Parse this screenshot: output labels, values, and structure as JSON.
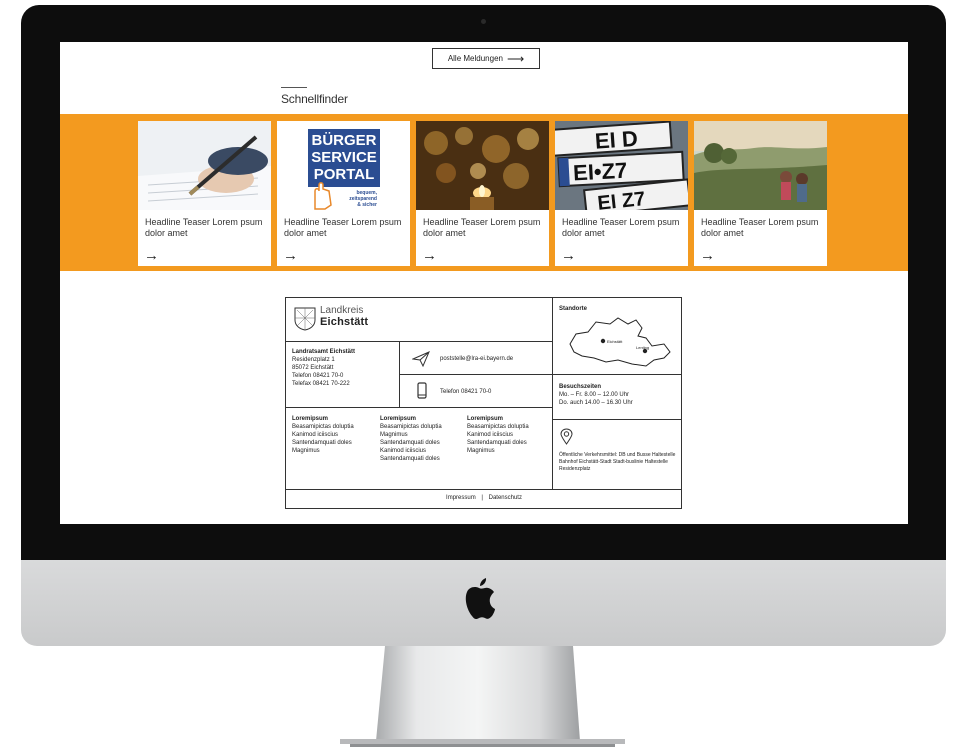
{
  "header": {
    "all_button_label": "Alle Meldungen",
    "arrow": "⟶"
  },
  "schnellfinder": {
    "title": "Schnellfinder",
    "cards": [
      {
        "image": "hand-writing-pen-photo",
        "text": "Headline Teaser Lorem psum dolor amet",
        "arrow": "→"
      },
      {
        "image": "buerger-service-portal-logo",
        "text": "Headline Teaser Lorem psum dolor amet",
        "arrow": "→"
      },
      {
        "image": "candle-bokeh-photo",
        "text": "Headline Teaser Lorem psum dolor amet",
        "arrow": "→"
      },
      {
        "image": "license-plates-photo",
        "text": "Headline Teaser Lorem psum dolor amet",
        "arrow": "→"
      },
      {
        "image": "hikers-landscape-photo",
        "text": "Headline Teaser Lorem psum dolor amet",
        "arrow": "→"
      }
    ],
    "portal_lines": [
      "BÜRGER",
      "SERVICE",
      "PORTAL"
    ],
    "portal_tagline": [
      "bequem,",
      "zeitsparend",
      "& sicher"
    ],
    "plate_texts": [
      "EI D",
      "EI•Z7",
      "EI Z7"
    ]
  },
  "footer": {
    "logo": {
      "line1": "Landkreis",
      "line2": "Eichstätt"
    },
    "office": {
      "name": "Landratsamt Eichstätt",
      "street": "Residenzplatz 1",
      "city": "85072 Eichstätt",
      "phone": "Telefon 08421 70-0",
      "fax": "Telefax 08421 70-222"
    },
    "email": "poststelle@lra-ei.bayern.de",
    "telephone": "Telefon 08421 70-0",
    "link_columns": [
      {
        "heading": "Loremipsum",
        "items": [
          "Beasamipictas doluptia",
          "Kanimod iciiscius",
          "Santendamquati doles",
          "Magnimus"
        ]
      },
      {
        "heading": "Loremipsum",
        "items": [
          "Beasamipictas doluptia",
          "Magnimus",
          "Santendamquati doles",
          "Kanimod iciiscius",
          "Santendamquati doles"
        ]
      },
      {
        "heading": "Loremipsum",
        "items": [
          "Beasamipictas doluptia",
          "Kanimod iciiscius",
          "Santendamquati doles",
          "Magnimus"
        ]
      }
    ],
    "standorte": {
      "title": "Standorte",
      "city1": "Eichstätt",
      "city2": "Lenting"
    },
    "besuchszeiten": {
      "title": "Besuchszeiten",
      "line1": "Mo. – Fr. 8.00 – 12.00 Uhr",
      "line2": "Do. auch 14.00 – 16.30 Uhr"
    },
    "transport": "Öffentliche Verkehrsmittel: DB und Busse Haltestelle Bahnhof Eichstätt-Stadt Stadt-buslinie Haltestelle Residenzplatz",
    "legal": {
      "impressum": "Impressum",
      "separator": "|",
      "datenschutz": "Datenschutz"
    }
  }
}
